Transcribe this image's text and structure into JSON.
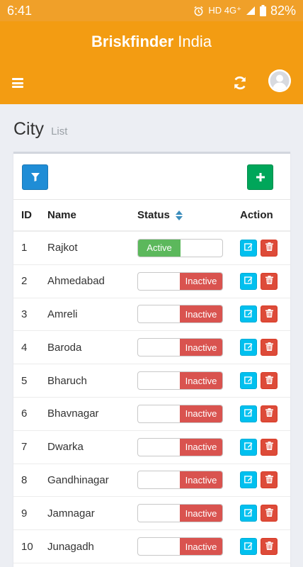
{
  "status_bar": {
    "time": "6:41",
    "network": "HD 4G⁺",
    "battery": "82%"
  },
  "app": {
    "brand_bold": "Briskfinder",
    "brand_light": "India"
  },
  "page": {
    "title": "City",
    "subtitle": "List"
  },
  "table": {
    "headers": {
      "id": "ID",
      "name": "Name",
      "status": "Status",
      "action": "Action"
    },
    "rows": [
      {
        "id": "1",
        "name": "Rajkot",
        "status": "Active"
      },
      {
        "id": "2",
        "name": "Ahmedabad",
        "status": "Inactive"
      },
      {
        "id": "3",
        "name": "Amreli",
        "status": "Inactive"
      },
      {
        "id": "4",
        "name": "Baroda",
        "status": "Inactive"
      },
      {
        "id": "5",
        "name": "Bharuch",
        "status": "Inactive"
      },
      {
        "id": "6",
        "name": "Bhavnagar",
        "status": "Inactive"
      },
      {
        "id": "7",
        "name": "Dwarka",
        "status": "Inactive"
      },
      {
        "id": "8",
        "name": "Gandhinagar",
        "status": "Inactive"
      },
      {
        "id": "9",
        "name": "Jamnagar",
        "status": "Inactive"
      },
      {
        "id": "10",
        "name": "Junagadh",
        "status": "Inactive"
      }
    ]
  },
  "icons": {
    "menu": "hamburger-icon",
    "refresh": "refresh-icon",
    "avatar": "user-avatar-icon",
    "filter": "filter-icon",
    "add": "plus-icon",
    "sort": "sort-icon",
    "edit": "edit-icon",
    "delete": "trash-icon"
  },
  "colors": {
    "appbar": "#f39c12",
    "active": "#5cb85c",
    "inactive": "#d9534f",
    "filter_button": "#1f8dd6",
    "add_button": "#00a65a",
    "edit_button": "#00c0ef",
    "delete_button": "#dd4b39"
  }
}
